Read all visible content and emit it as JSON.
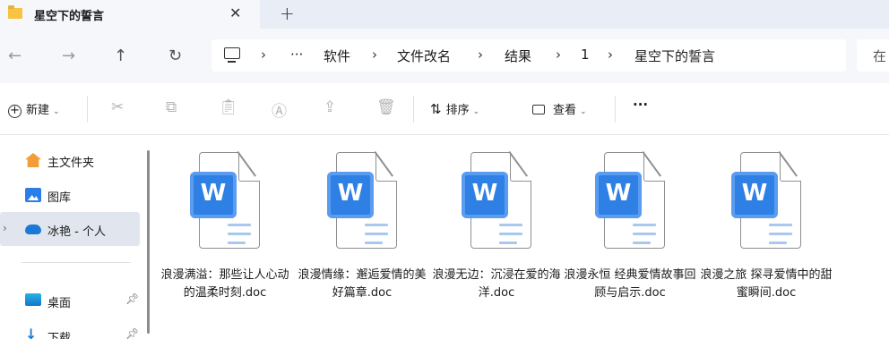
{
  "tab": {
    "title": "星空下的誓言",
    "close": "✕",
    "new": "+"
  },
  "nav": {
    "back": "←",
    "forward": "→",
    "up": "↑",
    "refresh": "↻"
  },
  "address": {
    "ellipsis": "···",
    "sep": "›",
    "crumbs": [
      "软件",
      "文件改名",
      "结果",
      "1",
      "星空下的誓言"
    ]
  },
  "search": {
    "placeholder": "在"
  },
  "toolbar": {
    "new_label": "新建",
    "sort_label": "排序",
    "view_label": "查看",
    "more_label": "···",
    "caret": "⌄"
  },
  "sidebar": {
    "items": [
      {
        "label": "主文件夹",
        "icon": "home-icon"
      },
      {
        "label": "图库",
        "icon": "gallery-icon"
      },
      {
        "label": "冰艳 - 个人",
        "icon": "cloud-icon"
      },
      {
        "label": "桌面",
        "icon": "desktop-icon"
      },
      {
        "label": "下载",
        "icon": "download-icon"
      }
    ]
  },
  "files": [
    {
      "name": "浪漫满溢：那些让人心动的温柔时刻.doc",
      "badge": "W"
    },
    {
      "name": "浪漫情缘：邂逅爱情的美好篇章.doc",
      "badge": "W"
    },
    {
      "name": "浪漫无边：沉浸在爱的海洋.doc",
      "badge": "W"
    },
    {
      "name": "浪漫永恒 经典爱情故事回顾与启示.doc",
      "badge": "W"
    },
    {
      "name": "浪漫之旅 探寻爱情中的甜蜜瞬间.doc",
      "badge": "W"
    }
  ],
  "colors": {
    "accent": "#2f80e4",
    "tab_bg": "#e9eef6",
    "selected_bg": "#e1e6ee"
  }
}
